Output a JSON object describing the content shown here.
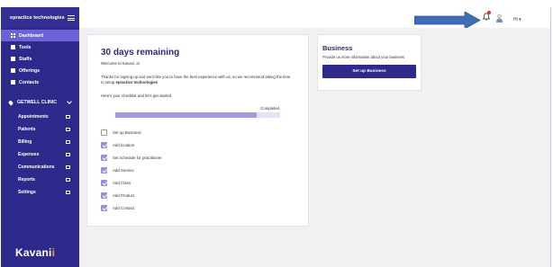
{
  "sidebar": {
    "brand": "epractice technologies",
    "items": [
      {
        "label": "Dashboard",
        "icon": "dashboard-icon",
        "active": true
      },
      {
        "label": "Tools",
        "icon": "tools-icon"
      },
      {
        "label": "Staffs",
        "icon": "staffs-icon"
      },
      {
        "label": "Offerings",
        "icon": "offerings-icon"
      },
      {
        "label": "Contacts",
        "icon": "contacts-icon"
      }
    ],
    "clinic": "GETWELL CLINIC",
    "clinic_items": [
      {
        "label": "Appointments",
        "icon": "calendar-icon"
      },
      {
        "label": "Patients",
        "icon": "patients-icon"
      },
      {
        "label": "Billing",
        "icon": "billing-icon"
      },
      {
        "label": "Expenses",
        "icon": "expenses-icon"
      },
      {
        "label": "Communications",
        "icon": "chat-icon"
      },
      {
        "label": "Reports",
        "icon": "reports-icon"
      },
      {
        "label": "Settings",
        "icon": "gear-icon"
      }
    ],
    "logo": "Kavani",
    "logo_dot": "i"
  },
  "topbar": {
    "user_menu": "Hi",
    "arrow_color": "#3d6cb8",
    "badge_color": "#e0322c"
  },
  "main_card": {
    "title": "30 days remaining",
    "welcome": "Welcome to Kavani, a!",
    "intro": "Thanks for signing up and we'd like you to have the best experience with us, so we recommend taking the time to setup ",
    "intro_bold": "epractice technologies",
    "checklist_label": "Here's your checklist and let's get started",
    "progress_label": "Completed",
    "progress_fraction": 0.86,
    "checklist": [
      {
        "label": "Set up Business",
        "checked": false
      },
      {
        "label": "Add location",
        "checked": true
      },
      {
        "label": "Set schedule for practitioner",
        "checked": true
      },
      {
        "label": "Add Service",
        "checked": true
      },
      {
        "label": "Add Class",
        "checked": true
      },
      {
        "label": "Add Product",
        "checked": true
      },
      {
        "label": "Add Contact",
        "checked": true
      }
    ]
  },
  "business_card": {
    "title": "Business",
    "description": "Provide us more information about your business",
    "button": "Set up Business"
  },
  "colors": {
    "sidebar": "#2e2a8c",
    "active": "#6c63d9",
    "accent": "#9b8fd6"
  }
}
